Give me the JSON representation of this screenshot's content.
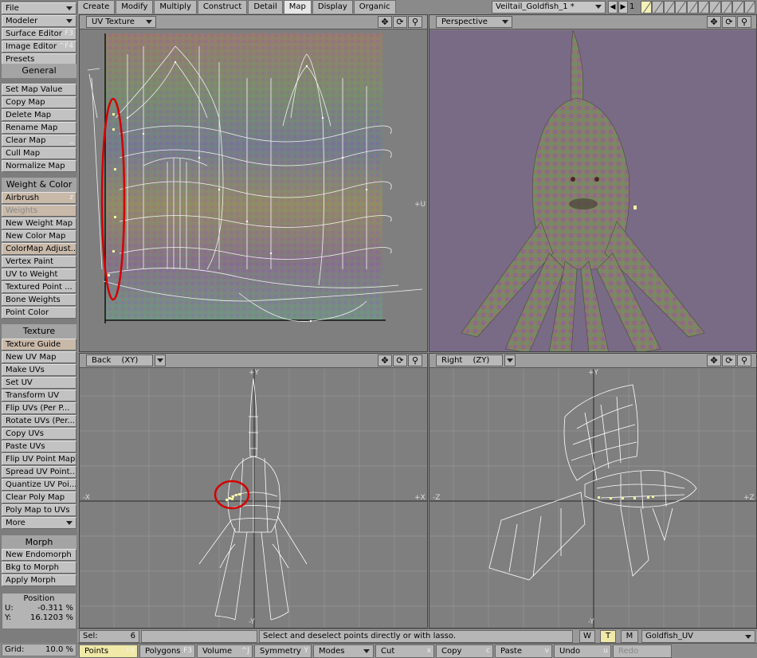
{
  "sidebar": {
    "top": [
      {
        "label": "File",
        "type": "dropdown"
      },
      {
        "label": "Modeler",
        "type": "dropdown"
      },
      {
        "label": "Surface Editor",
        "hotkey": "F3"
      },
      {
        "label": "Image Editor",
        "hotkey": "^F4"
      },
      {
        "label": "Presets",
        "hotkey": ""
      }
    ],
    "general_header": "General",
    "general": [
      {
        "label": "Set Map Value"
      },
      {
        "label": "Copy Map"
      },
      {
        "label": "Delete Map"
      },
      {
        "label": "Rename Map"
      },
      {
        "label": "Clear Map",
        "hotkey": "_"
      },
      {
        "label": "Cull Map"
      },
      {
        "label": "Normalize Map"
      }
    ],
    "weight_header": "Weight & Color",
    "weight": [
      {
        "label": "Airbrush",
        "hotkey": "z",
        "style": "tan"
      },
      {
        "label": "Weights",
        "style": "disabled"
      },
      {
        "label": "New Weight Map"
      },
      {
        "label": "New Color Map"
      },
      {
        "label": "ColorMap Adjust...",
        "style": "tan"
      },
      {
        "label": "Vertex Paint"
      },
      {
        "label": "UV to Weight"
      },
      {
        "label": "Textured Point ..."
      },
      {
        "label": "Bone Weights"
      },
      {
        "label": "Point Color"
      }
    ],
    "texture_header": "Texture",
    "texture": [
      {
        "label": "Texture Guide",
        "style": "tan"
      },
      {
        "label": "New UV Map"
      },
      {
        "label": "Make UVs"
      },
      {
        "label": "Set UV"
      },
      {
        "label": "Transform UV"
      },
      {
        "label": "Flip UVs (Per P..."
      },
      {
        "label": "Rotate UVs (Per..."
      },
      {
        "label": "Copy UVs"
      },
      {
        "label": "Paste UVs"
      },
      {
        "label": "Flip UV Point Map"
      },
      {
        "label": "Spread UV Point..."
      },
      {
        "label": "Quantize UV Poi..."
      },
      {
        "label": "Clear Poly Map"
      },
      {
        "label": "Poly Map to UVs"
      },
      {
        "label": "More",
        "type": "dropdown"
      }
    ],
    "morph_header": "Morph",
    "morph": [
      {
        "label": "New Endomorph"
      },
      {
        "label": "Bkg to Morph"
      },
      {
        "label": "Apply Morph"
      }
    ],
    "position": {
      "title": "Position",
      "u_label": "U:",
      "u_value": "-0.311 %",
      "v_label": "Y:",
      "v_value": "16.1203 %"
    },
    "grid": {
      "label": "Grid:",
      "value": "10.0 %"
    }
  },
  "tabs": [
    {
      "label": "Create",
      "active": false
    },
    {
      "label": "Modify",
      "active": false
    },
    {
      "label": "Multiply",
      "active": false
    },
    {
      "label": "Construct",
      "active": false
    },
    {
      "label": "Detail",
      "active": false
    },
    {
      "label": "Map",
      "active": true
    },
    {
      "label": "Display",
      "active": false
    },
    {
      "label": "Organic",
      "active": false
    }
  ],
  "scene": {
    "object_name": "Veiltail_Goldfish_1 *",
    "layer_number": "1"
  },
  "viewports": {
    "uv": {
      "label": "UV Texture",
      "axis_u": "+U"
    },
    "perspective": {
      "label": "Perspective"
    },
    "back": {
      "label": "Back",
      "axes": "(XY)",
      "pos_y": "+Y",
      "neg_y": "-Y",
      "pos_x": "+X",
      "neg_x": "-X"
    },
    "right": {
      "label": "Right",
      "axes": "(ZY)",
      "pos_y": "+Y",
      "neg_y": "-Y",
      "pos_z": "+Z",
      "neg_z": "-Z"
    }
  },
  "status": {
    "sel_label": "Sel:",
    "sel_value": "6",
    "message": "Select and deselect points directly or with lasso.",
    "w_label": "W",
    "t_label": "T",
    "m_label": "M",
    "vmap": "Goldfish_UV"
  },
  "bottom": [
    {
      "label": "Points",
      "hotkey": "F4",
      "style": "on"
    },
    {
      "label": "Polygons",
      "hotkey": "F3"
    },
    {
      "label": "Volume",
      "hotkey": "^J"
    },
    {
      "label": "Symmetry",
      "hotkey": "Y"
    },
    {
      "label": "Modes",
      "type": "dropdown"
    },
    {
      "label": "Cut",
      "hotkey": "x"
    },
    {
      "label": "Copy",
      "hotkey": "c"
    },
    {
      "label": "Paste",
      "hotkey": "v"
    },
    {
      "label": "Undo",
      "hotkey": "u"
    },
    {
      "label": "Redo",
      "style": "dim"
    }
  ],
  "colors": {
    "perspective_bg": "#796a86",
    "selection_circle": "#d40000",
    "selected_point": "#f2f3a0",
    "wire": "#ffffff"
  }
}
